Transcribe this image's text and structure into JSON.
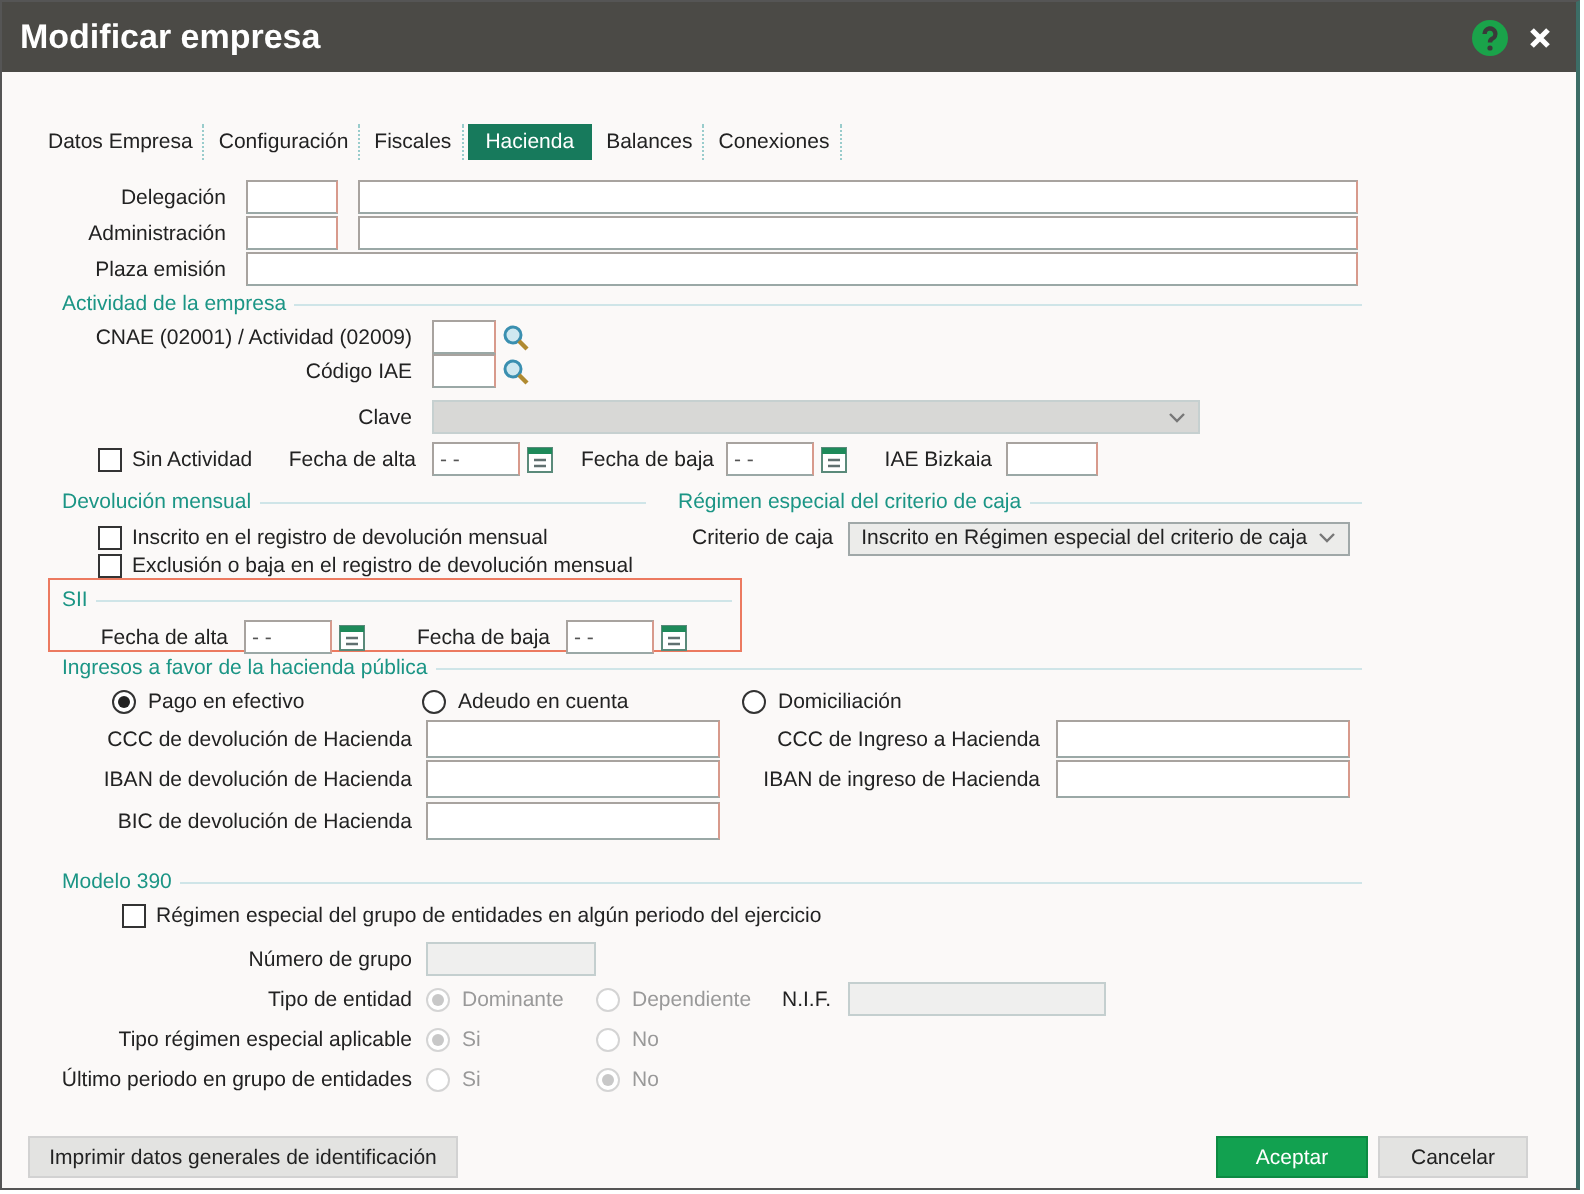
{
  "window": {
    "title": "Modificar empresa"
  },
  "tabs": [
    {
      "label": "Datos Empresa",
      "selected": false
    },
    {
      "label": "Configuración",
      "selected": false
    },
    {
      "label": "Fiscales",
      "selected": false
    },
    {
      "label": "Hacienda",
      "selected": true
    },
    {
      "label": "Balances",
      "selected": false
    },
    {
      "label": "Conexiones",
      "selected": false
    }
  ],
  "oficina": {
    "delegacion_label": "Delegación",
    "administracion_label": "Administración",
    "plaza_emision_label": "Plaza emisión"
  },
  "actividad": {
    "title": "Actividad de la empresa",
    "cnae_label": "CNAE (02001) / Actividad (02009)",
    "codigo_iae_label": "Código IAE",
    "clave": {
      "label": "Clave",
      "disabled": true
    },
    "sin_actividad": {
      "label": "Sin Actividad",
      "checked": false
    },
    "fecha_alta": {
      "label": "Fecha de alta",
      "value": "- -"
    },
    "fecha_baja": {
      "label": "Fecha de baja",
      "value": "- -"
    },
    "iae_bizkaia_label": "IAE Bizkaia"
  },
  "devolucion_mensual": {
    "title": "Devolución mensual",
    "options": [
      {
        "label": "Inscrito en el registro de devolución mensual",
        "checked": false
      },
      {
        "label": "Exclusión o baja en el registro de devolución mensual",
        "checked": false
      }
    ]
  },
  "criterio_caja": {
    "title": "Régimen especial del criterio de caja",
    "label": "Criterio de caja",
    "value": "Inscrito en Régimen especial del criterio de caja"
  },
  "sii": {
    "title": "SII",
    "highlighted": true,
    "fecha_alta": {
      "label": "Fecha de alta",
      "value": "- -"
    },
    "fecha_baja": {
      "label": "Fecha de baja",
      "value": "- -"
    }
  },
  "ingresos": {
    "title": "Ingresos a favor de la hacienda pública",
    "payment_methods": [
      {
        "label": "Pago en efectivo",
        "selected": true
      },
      {
        "label": "Adeudo en cuenta",
        "selected": false
      },
      {
        "label": "Domiciliación",
        "selected": false
      }
    ],
    "devolucion_fields": [
      {
        "label": "CCC de devolución de Hacienda"
      },
      {
        "label": "IBAN de devolución de Hacienda"
      },
      {
        "label": "BIC de devolución de Hacienda"
      }
    ],
    "ingreso_fields": [
      {
        "label": "CCC de Ingreso a Hacienda"
      },
      {
        "label": "IBAN de ingreso de Hacienda"
      }
    ]
  },
  "modelo_390": {
    "title": "Modelo 390",
    "regimen_especial": {
      "label": "Régimen especial del grupo de entidades en algún periodo del ejercicio",
      "checked": false
    },
    "numero_grupo": {
      "label": "Número de grupo",
      "disabled": true
    },
    "radio_rows": [
      {
        "label": "Tipo de entidad",
        "disabled": true,
        "options": [
          {
            "label": "Dominante",
            "selected": true
          },
          {
            "label": "Dependiente",
            "selected": false
          }
        ],
        "extra_field": {
          "label": "N.I.F.",
          "disabled": true
        }
      },
      {
        "label": "Tipo régimen especial aplicable",
        "disabled": true,
        "options": [
          {
            "label": "Si",
            "selected": true
          },
          {
            "label": "No",
            "selected": false
          }
        ]
      },
      {
        "label": "Último periodo en grupo de entidades",
        "disabled": true,
        "options": [
          {
            "label": "Si",
            "selected": false
          },
          {
            "label": "No",
            "selected": true
          }
        ]
      }
    ]
  },
  "buttons": [
    {
      "label": "Imprimir datos generales de identificación",
      "kind": "secondary"
    },
    {
      "label": "Aceptar",
      "kind": "primary"
    },
    {
      "label": "Cancelar",
      "kind": "secondary"
    }
  ]
}
